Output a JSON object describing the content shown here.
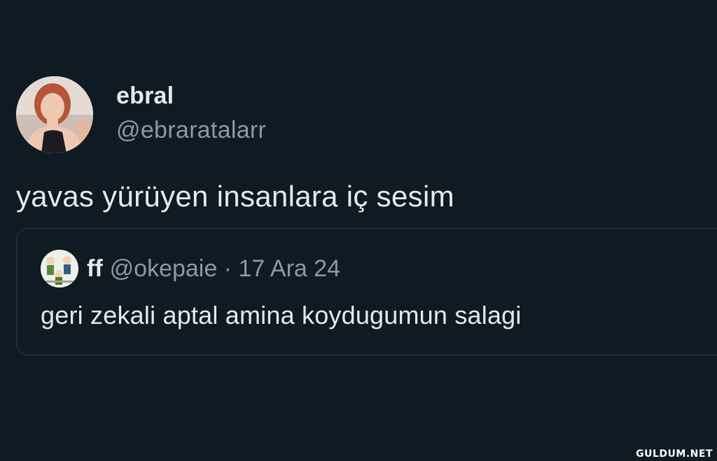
{
  "tweet": {
    "display_name": "ebral",
    "handle": "@ebraratalarr",
    "text": "yavas yürüyen insanlara iç sesim",
    "avatar_icon": "profile-photo"
  },
  "quote": {
    "display_name": "ff",
    "handle": "@okepaie",
    "separator": "·",
    "date": "17 Ara 24",
    "text": "geri zekali aptal amina koydugumun salagi",
    "avatar_icon": "cartoon-characters-avatar"
  },
  "watermark": "GULDUM.NET",
  "colors": {
    "background": "#0f1a23",
    "primary_text": "#e7e9ea",
    "secondary_text": "#8b98a5",
    "card_border": "#2f3a45"
  }
}
